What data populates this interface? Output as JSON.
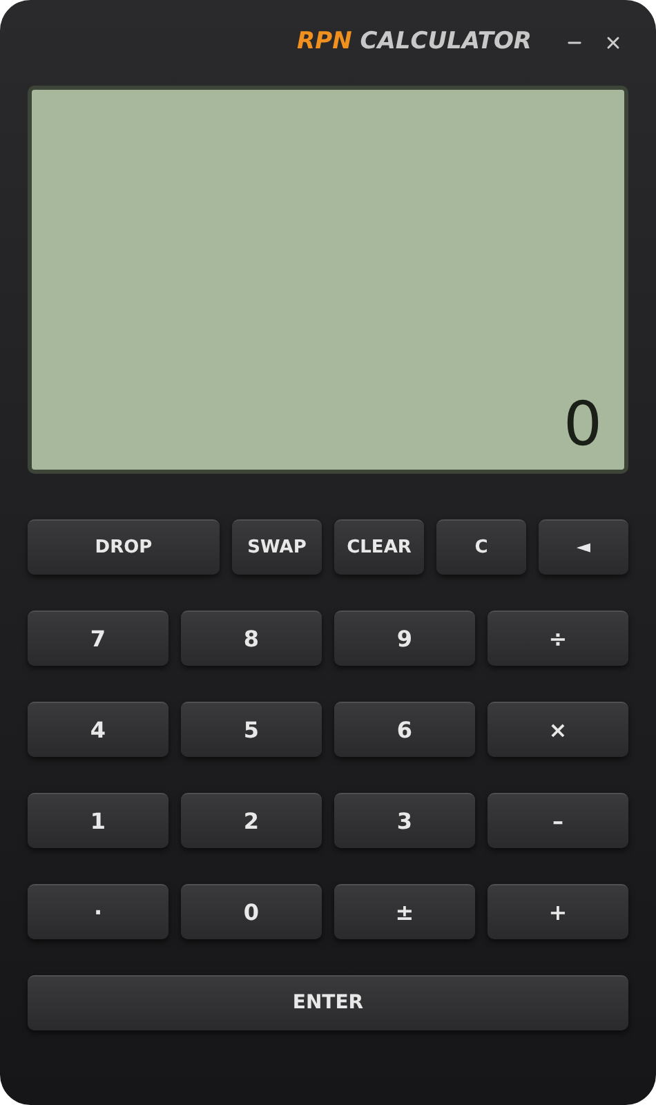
{
  "window": {
    "title_brand": "RPN",
    "title_rest": "CALCULATOR"
  },
  "display": {
    "value": "0"
  },
  "stack_row": [
    {
      "label": "DROP",
      "kind": "wide"
    },
    {
      "label": "SWAP",
      "kind": "normal"
    },
    {
      "label": "CLEAR",
      "kind": "normal"
    },
    {
      "label": "C",
      "kind": "normal"
    },
    {
      "label": "◄",
      "kind": "normal"
    }
  ],
  "keypad": [
    [
      "7",
      "8",
      "9",
      "÷"
    ],
    [
      "4",
      "5",
      "6",
      "×"
    ],
    [
      "1",
      "2",
      "3",
      "–"
    ],
    [
      "·",
      "0",
      "±",
      "+"
    ]
  ],
  "enter_key": "ENTER"
}
